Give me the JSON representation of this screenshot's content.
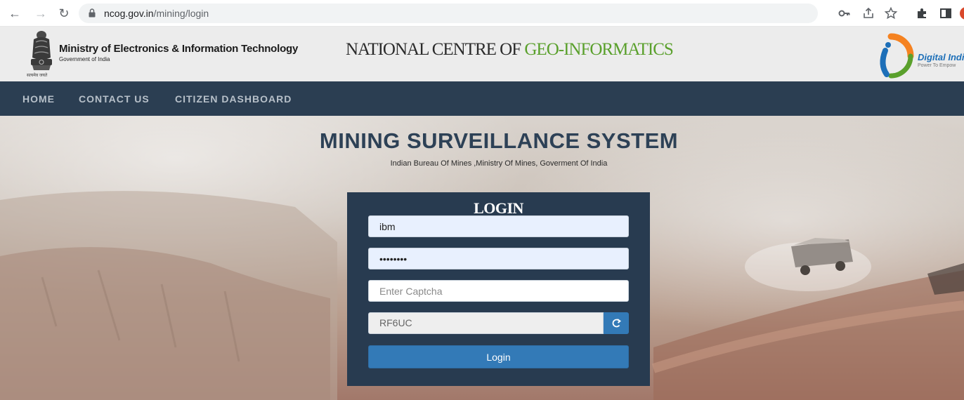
{
  "browser": {
    "url_host": "ncog.gov.in",
    "url_path": "/mining/login"
  },
  "header": {
    "ministry_title": "Ministry of Electronics & Information Technology",
    "ministry_subtitle": "Government of India",
    "emblem_caption": "सत्यमेव जयते",
    "ncog_title_part1": "NATIONAL CENTRE OF ",
    "ncog_title_part2": "GEO-INFORMATICS",
    "digital_india": "Digital Indi",
    "digital_india_sub": "Power To Empow"
  },
  "nav": {
    "items": [
      "HOME",
      "CONTACT US",
      "CITIZEN DASHBOARD"
    ]
  },
  "hero": {
    "title": "MINING SURVEILLANCE SYSTEM",
    "subtitle": "Indian Bureau Of Mines ,Ministry Of Mines, Goverment Of India"
  },
  "login": {
    "heading": "LOGIN",
    "username_value": "ibm",
    "password_value": "password",
    "captcha_placeholder": "Enter Captcha",
    "captcha_code": "RF6UC",
    "submit_label": "Login"
  },
  "colors": {
    "nav_bg": "#2b3e52",
    "panel_bg": "#283b50",
    "primary_button": "#337ab7",
    "title_color": "#2d4156",
    "geo_green": "#5aa02c"
  },
  "icons": {
    "back": "arrow-left-icon",
    "forward": "arrow-right-icon",
    "reload": "reload-icon",
    "lock": "lock-icon",
    "key": "key-icon",
    "share": "share-icon",
    "star": "star-icon",
    "extensions": "puzzle-icon",
    "sidepanel": "sidepanel-icon",
    "refresh_captcha": "refresh-icon"
  }
}
